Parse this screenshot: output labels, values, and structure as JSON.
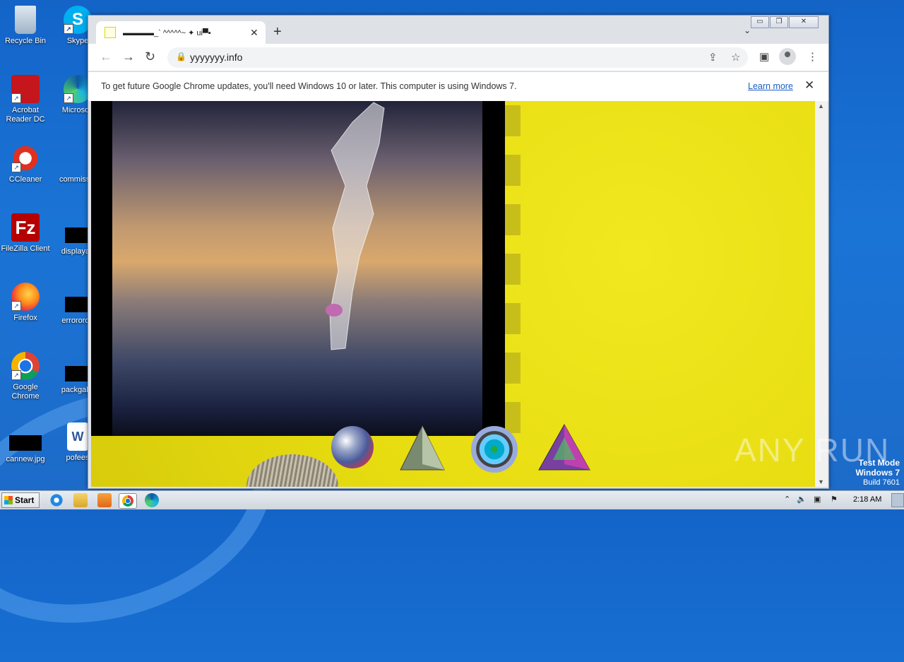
{
  "desktop": {
    "icons_col1": [
      {
        "label": "Recycle Bin",
        "icon": "recycle-bin-icon"
      },
      {
        "label": "Acrobat Reader DC",
        "icon": "acrobat-icon"
      },
      {
        "label": "CCleaner",
        "icon": "ccleaner-icon"
      },
      {
        "label": "FileZilla Client",
        "icon": "filezilla-icon"
      },
      {
        "label": "Firefox",
        "icon": "firefox-icon"
      },
      {
        "label": "Google Chrome",
        "icon": "chrome-icon"
      },
      {
        "label": "cannew.jpg",
        "icon": "image-file-icon"
      }
    ],
    "icons_col2": [
      {
        "label": "Skype",
        "icon": "skype-icon"
      },
      {
        "label": "Microsoft",
        "icon": "edge-icon"
      },
      {
        "label": "commissio",
        "icon": "file-icon"
      },
      {
        "label": "displayau",
        "icon": "file-icon"
      },
      {
        "label": "errororde",
        "icon": "file-icon"
      },
      {
        "label": "packgalle",
        "icon": "file-icon"
      },
      {
        "label": "pofees",
        "icon": "word-icon"
      }
    ],
    "watermark": "ANY RUN",
    "test_mode": {
      "line1": "Test Mode",
      "line2": "Windows 7",
      "line3": "Build 7601"
    }
  },
  "browser": {
    "tab_title": "▬▬▬▬_` ^^^^^~ ✦ ui▀▪",
    "url": "yyyyyyy.info",
    "infobar_message": "To get future Google Chrome updates, you'll need Windows 10 or later. This computer is using Windows 7.",
    "infobar_link": "Learn more",
    "colors": {
      "page_bg": "#e6dc10",
      "link": "#1a5fc4"
    }
  },
  "taskbar": {
    "start_label": "Start",
    "clock": "2:18 AM",
    "pinned": [
      "ie-icon",
      "explorer-icon",
      "media-player-icon",
      "chrome-icon",
      "edge-icon"
    ]
  }
}
